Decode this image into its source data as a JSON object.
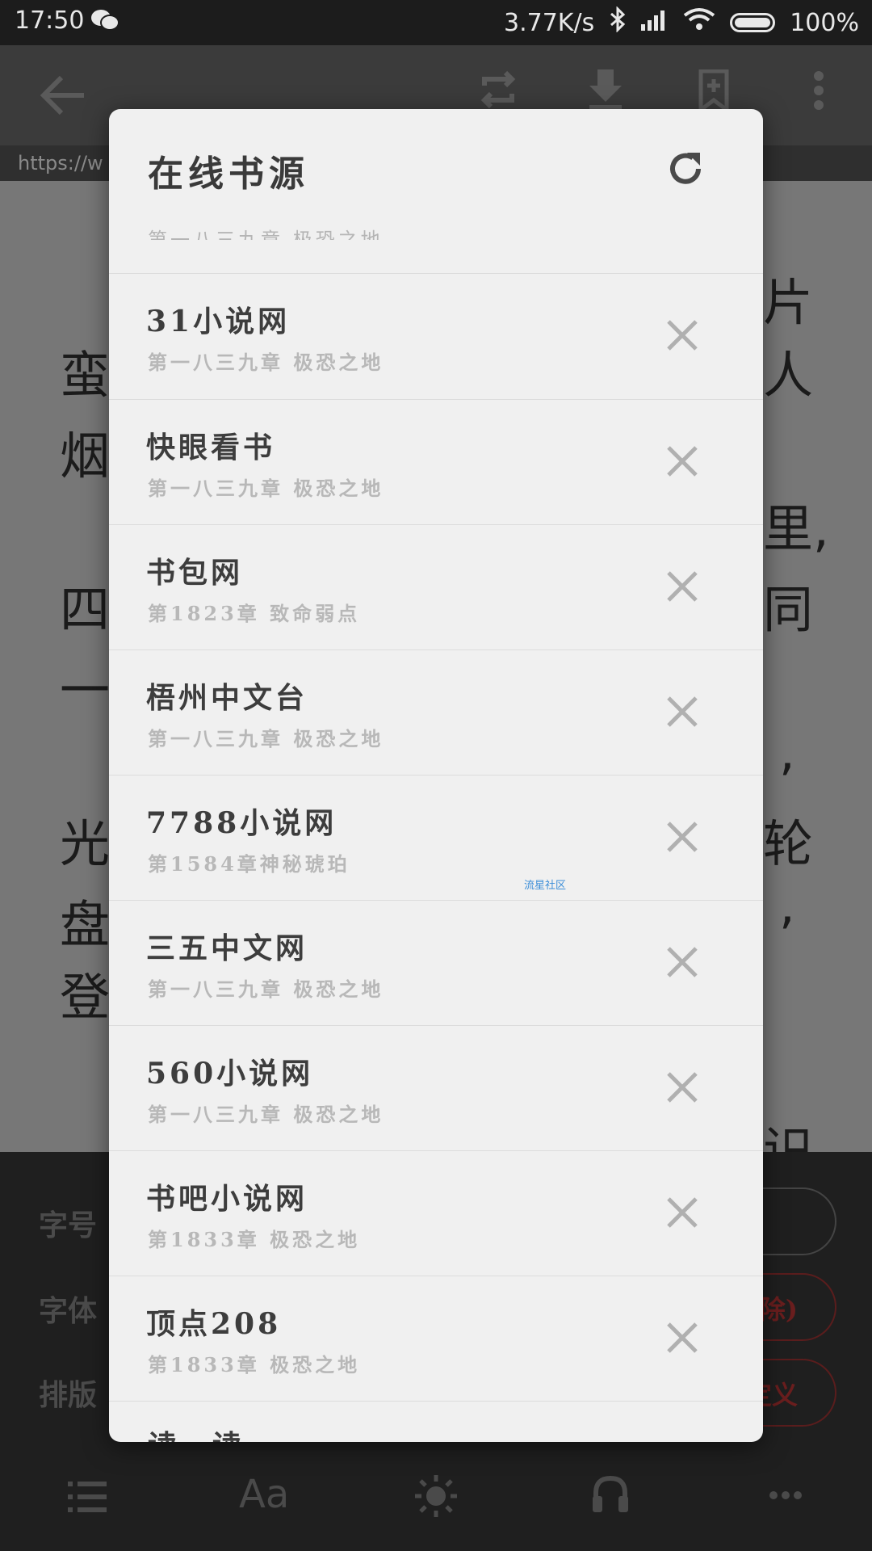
{
  "status_bar": {
    "time": "17:50",
    "net_speed": "3.77K/s",
    "battery": "100%"
  },
  "url_bar": {
    "text": "https://w"
  },
  "reader": {
    "fragments_left": [
      "蛮",
      "烟",
      "四",
      "一",
      "光",
      "盘",
      "登"
    ],
    "fragments_right": [
      "片",
      "人",
      "里,",
      "同",
      ",",
      "轮",
      ",",
      "识"
    ]
  },
  "settings": {
    "font_size_label": "字号",
    "font_label": "字体",
    "layout_label": "排版",
    "font_pill_text": "除)",
    "layout_pill_text": "定义"
  },
  "bottom_nav": {
    "font_button": "Aa"
  },
  "dialog": {
    "title": "在线书源",
    "partial_top_chapter": "第一八三九章 极恐之地",
    "sources": [
      {
        "name": "31小说网",
        "chapter": "第一八三九章 极恐之地"
      },
      {
        "name": "快眼看书",
        "chapter": "第一八三九章 极恐之地"
      },
      {
        "name": "书包网",
        "chapter": "第1823章 致命弱点"
      },
      {
        "name": "梧州中文台",
        "chapter": "第一八三九章 极恐之地"
      },
      {
        "name": "7788小说网",
        "chapter": "第1584章神秘琥珀"
      },
      {
        "name": "三五中文网",
        "chapter": "第一八三九章 极恐之地"
      },
      {
        "name": "560小说网",
        "chapter": "第一八三九章 极恐之地"
      },
      {
        "name": "书吧小说网",
        "chapter": "第1833章 极恐之地"
      },
      {
        "name": "顶点208",
        "chapter": "第1833章 极恐之地"
      }
    ],
    "partial_bottom_name": "读一读",
    "watermark": "流星社区"
  },
  "icons": {
    "back": "arrow-left-icon",
    "switch": "swap-icon",
    "download": "download-icon",
    "bookmark": "bookmark-add-icon",
    "more": "more-vertical-icon",
    "refresh": "refresh-icon",
    "close": "close-icon",
    "toc": "list-icon",
    "brightness": "sun-icon",
    "audio": "headphones-icon",
    "more_h": "more-horizontal-icon"
  }
}
